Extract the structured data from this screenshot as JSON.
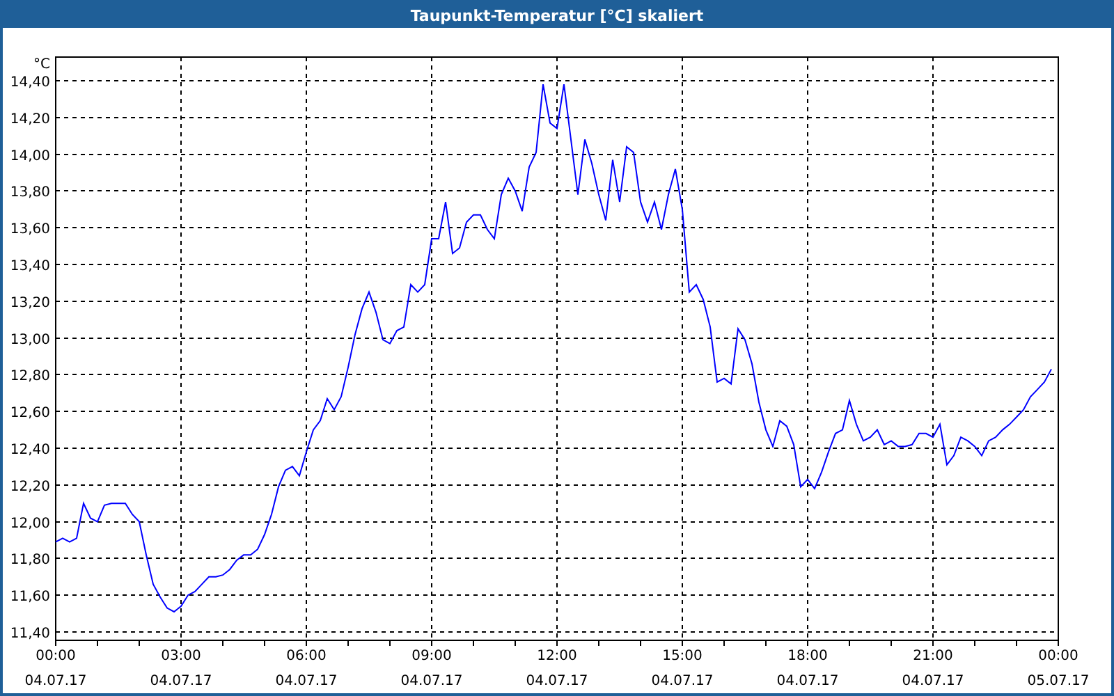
{
  "window": {
    "title": "Taupunkt-Temperatur [°C] skaliert"
  },
  "chart": {
    "chart_data": {
      "type": "line",
      "ylabel": "°C",
      "grid": true,
      "ylim": [
        11.4,
        14.4
      ],
      "yticks": [
        {
          "value": 11.4,
          "label": "11,40"
        },
        {
          "value": 11.6,
          "label": "11,60"
        },
        {
          "value": 11.8,
          "label": "11,80"
        },
        {
          "value": 12.0,
          "label": "12,00"
        },
        {
          "value": 12.2,
          "label": "12,20"
        },
        {
          "value": 12.4,
          "label": "12,40"
        },
        {
          "value": 12.6,
          "label": "12,60"
        },
        {
          "value": 12.8,
          "label": "12,80"
        },
        {
          "value": 13.0,
          "label": "13,00"
        },
        {
          "value": 13.2,
          "label": "13,20"
        },
        {
          "value": 13.4,
          "label": "13,40"
        },
        {
          "value": 13.6,
          "label": "13,60"
        },
        {
          "value": 13.8,
          "label": "13,80"
        },
        {
          "value": 14.0,
          "label": "14,00"
        },
        {
          "value": 14.2,
          "label": "14,20"
        },
        {
          "value": 14.4,
          "label": "14,40"
        }
      ],
      "categories": [
        "00:00\n04.07.17",
        null,
        null,
        null,
        null,
        null,
        null,
        null,
        null,
        null,
        null,
        null,
        null,
        null,
        null,
        null,
        null,
        null,
        "03:00\n04.07.17",
        null,
        null,
        null,
        null,
        null,
        null,
        null,
        null,
        null,
        null,
        null,
        null,
        null,
        null,
        null,
        null,
        null,
        "06:00\n04.07.17",
        null,
        null,
        null,
        null,
        null,
        null,
        null,
        null,
        null,
        null,
        null,
        null,
        null,
        null,
        null,
        null,
        null,
        "09:00\n04.07.17",
        null,
        null,
        null,
        null,
        null,
        null,
        null,
        null,
        null,
        null,
        null,
        null,
        null,
        null,
        null,
        null,
        null,
        "12:00\n04.07.17",
        null,
        null,
        null,
        null,
        null,
        null,
        null,
        null,
        null,
        null,
        null,
        null,
        null,
        null,
        null,
        null,
        null,
        "15:00\n04.07.17",
        null,
        null,
        null,
        null,
        null,
        null,
        null,
        null,
        null,
        null,
        null,
        null,
        null,
        null,
        null,
        null,
        null,
        "18:00\n04.07.17",
        null,
        null,
        null,
        null,
        null,
        null,
        null,
        null,
        null,
        null,
        null,
        null,
        null,
        null,
        null,
        null,
        null,
        "21:00\n04.07.17",
        null,
        null,
        null,
        null,
        null,
        null,
        null,
        null,
        null,
        null,
        null,
        null,
        null,
        null,
        null,
        null,
        null,
        "00:00\n05.07.17"
      ],
      "series": [
        {
          "color": "#0000ff",
          "values": [
            11.89,
            11.91,
            11.89,
            11.91,
            12.1,
            12.02,
            12.0,
            12.09,
            12.1,
            12.1,
            12.1,
            12.04,
            12.0,
            11.82,
            11.66,
            11.59,
            11.53,
            11.51,
            11.54,
            11.6,
            11.62,
            11.66,
            11.7,
            11.7,
            11.71,
            11.74,
            11.79,
            11.82,
            11.82,
            11.85,
            11.93,
            12.04,
            12.19,
            12.28,
            12.3,
            12.25,
            12.38,
            12.5,
            12.55,
            12.67,
            12.61,
            12.68,
            12.84,
            13.02,
            13.16,
            13.25,
            13.14,
            12.99,
            12.97,
            13.04,
            13.06,
            13.29,
            13.25,
            13.29,
            13.54,
            13.54,
            13.74,
            13.46,
            13.49,
            13.63,
            13.67,
            13.67,
            13.59,
            13.54,
            13.78,
            13.87,
            13.8,
            13.69,
            13.93,
            14.01,
            14.38,
            14.17,
            14.14,
            14.38,
            14.08,
            13.78,
            14.08,
            13.95,
            13.78,
            13.64,
            13.97,
            13.74,
            14.04,
            14.01,
            13.74,
            13.63,
            13.74,
            13.59,
            13.78,
            13.92,
            13.7,
            13.25,
            13.29,
            13.21,
            13.06,
            12.76,
            12.78,
            12.75,
            13.05,
            12.99,
            12.86,
            12.65,
            12.5,
            12.41,
            12.55,
            12.52,
            12.42,
            12.19,
            12.23,
            12.18,
            12.27,
            12.38,
            12.48,
            12.5,
            12.66,
            12.53,
            12.44,
            12.46,
            12.5,
            12.42,
            12.44,
            12.41,
            12.41,
            12.42,
            12.48,
            12.48,
            12.46,
            12.53,
            12.31,
            12.36,
            12.46,
            12.44,
            12.41,
            12.36,
            12.44,
            12.46,
            12.5,
            12.53,
            12.57,
            12.61,
            12.68,
            12.72,
            12.76,
            12.83,
            null
          ]
        }
      ]
    }
  }
}
